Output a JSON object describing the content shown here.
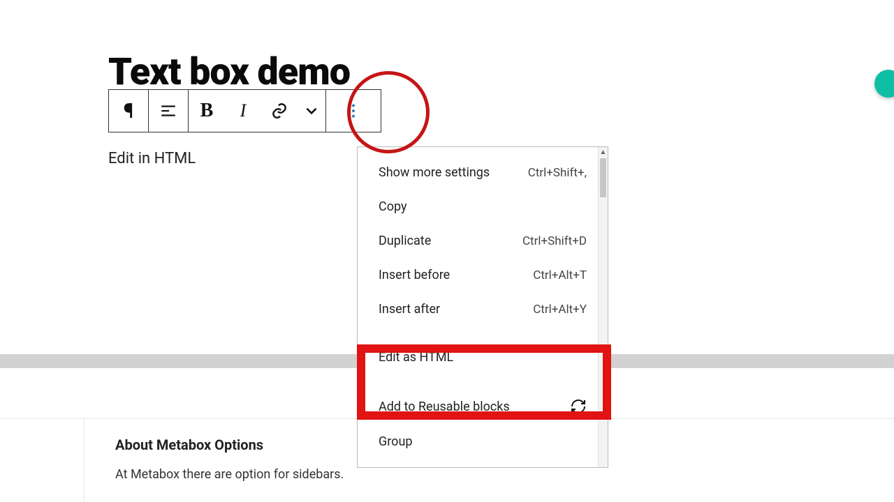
{
  "title": "Text box demo",
  "body_text": "Edit in HTML",
  "toolbar": {
    "paragraph": "¶",
    "bold": "B",
    "italic": "I"
  },
  "menu": {
    "items": [
      {
        "label": "Show more settings",
        "shortcut": "Ctrl+Shift+,"
      },
      {
        "label": "Copy",
        "shortcut": ""
      },
      {
        "label": "Duplicate",
        "shortcut": "Ctrl+Shift+D"
      },
      {
        "label": "Insert before",
        "shortcut": "Ctrl+Alt+T"
      },
      {
        "label": "Insert after",
        "shortcut": "Ctrl+Alt+Y"
      }
    ],
    "highlighted": {
      "label": "Edit as HTML",
      "shortcut": ""
    },
    "footer": [
      {
        "label": "Add to Reusable blocks",
        "shortcut": "",
        "icon": "refresh"
      },
      {
        "label": "Group",
        "shortcut": ""
      }
    ]
  },
  "metabox": {
    "title": "About Metabox Options",
    "desc": "At Metabox there are option for sidebars."
  }
}
